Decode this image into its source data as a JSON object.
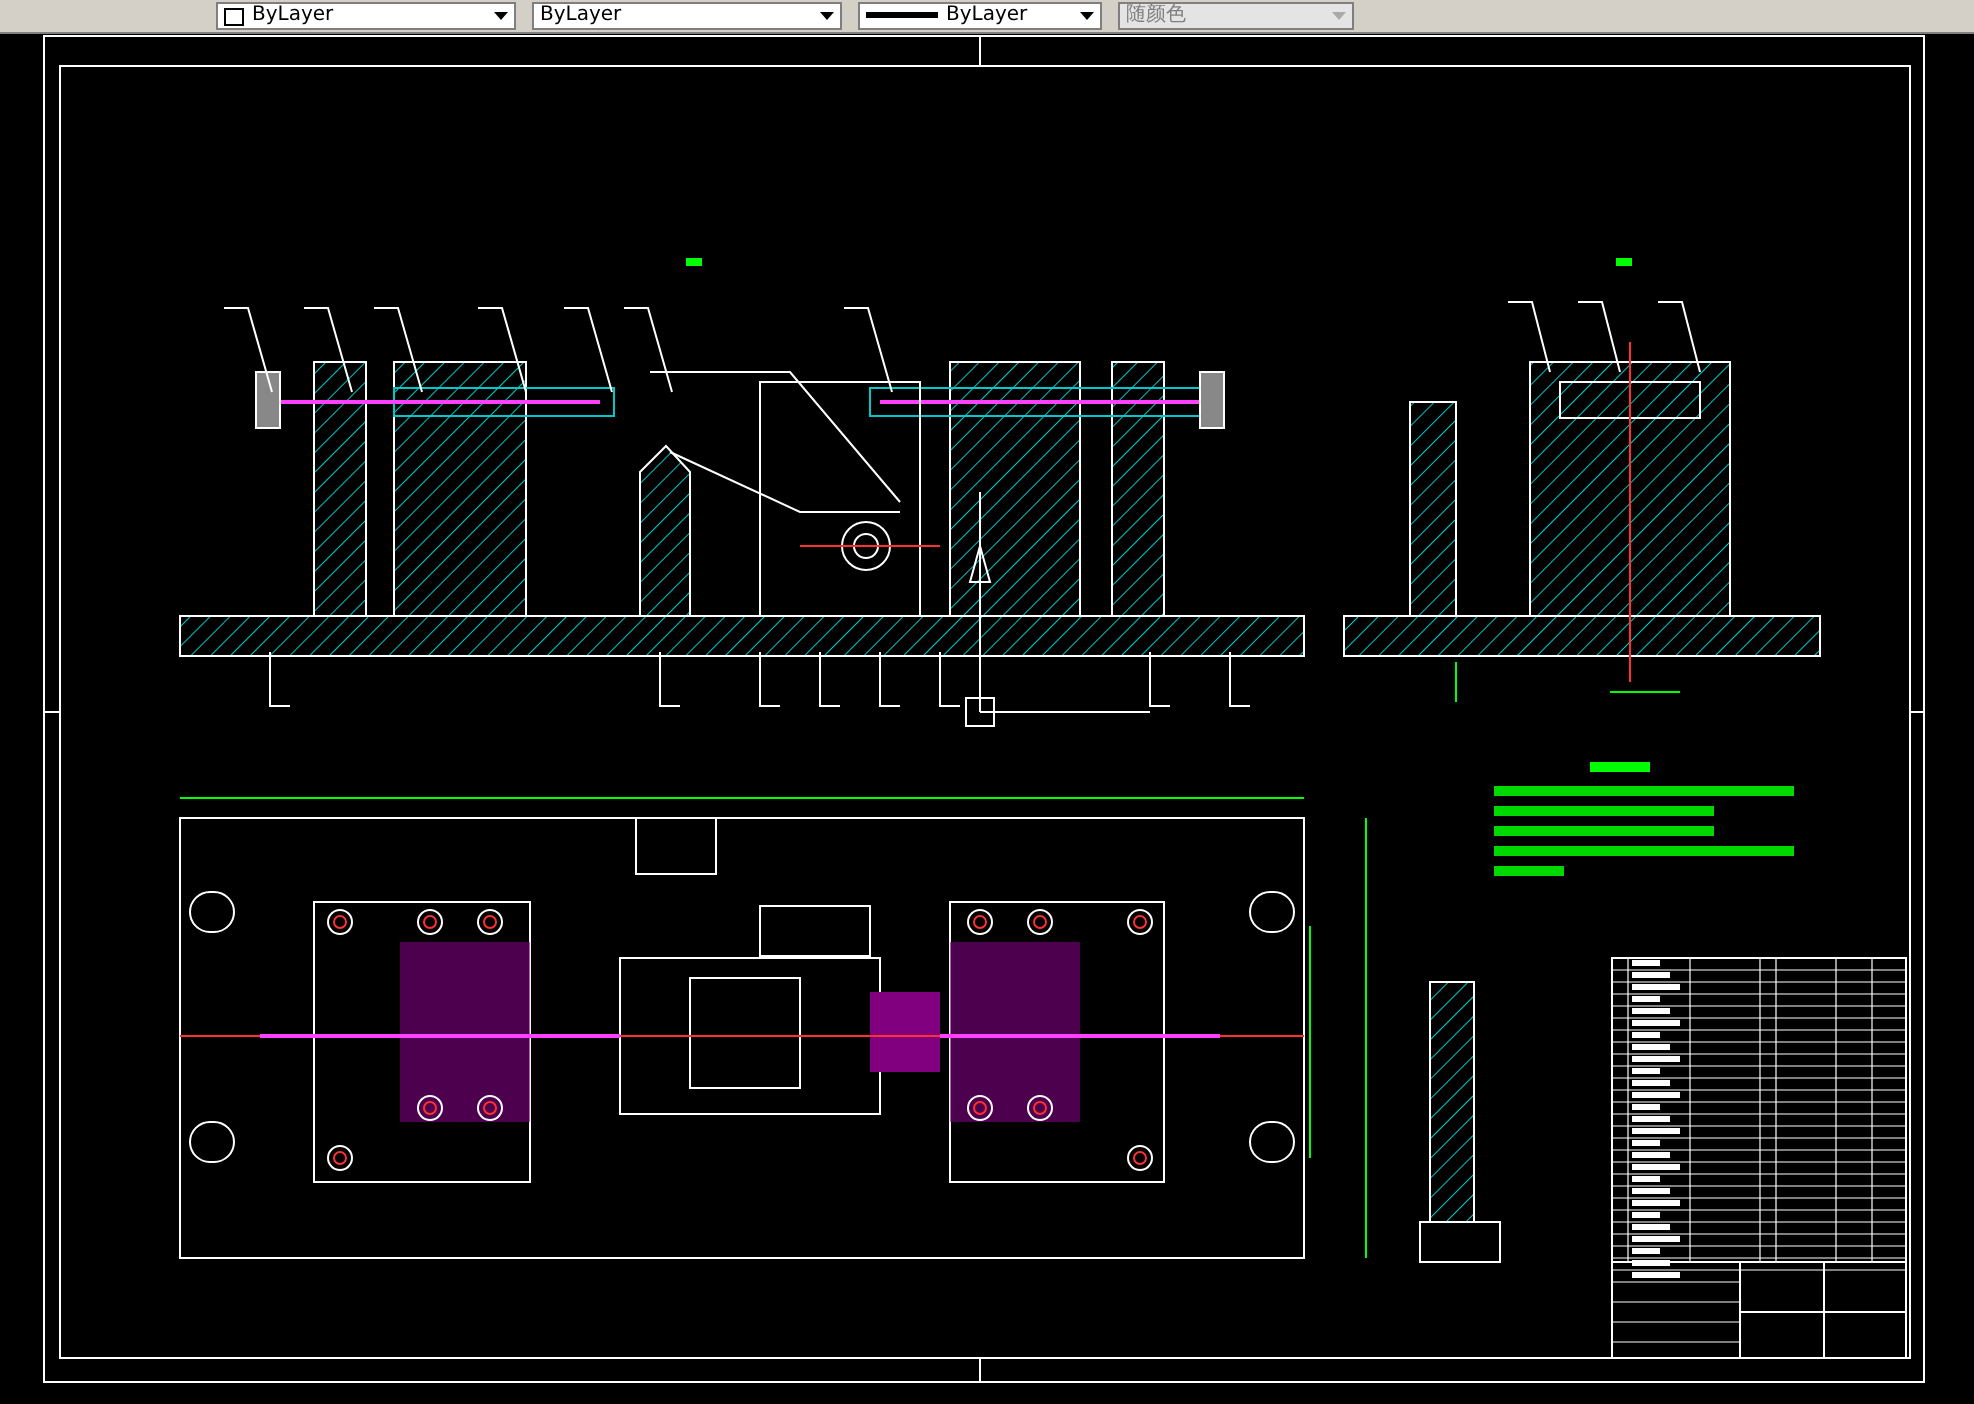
{
  "toolbar": {
    "dropdowns": [
      {
        "kind": "color",
        "value": "ByLayer",
        "disabled": false
      },
      {
        "kind": "linetype",
        "value": "ByLayer",
        "disabled": false
      },
      {
        "kind": "lineweight",
        "value": "ByLayer",
        "disabled": false
      },
      {
        "kind": "plotstyle",
        "value": "随颜色",
        "disabled": true
      }
    ]
  }
}
